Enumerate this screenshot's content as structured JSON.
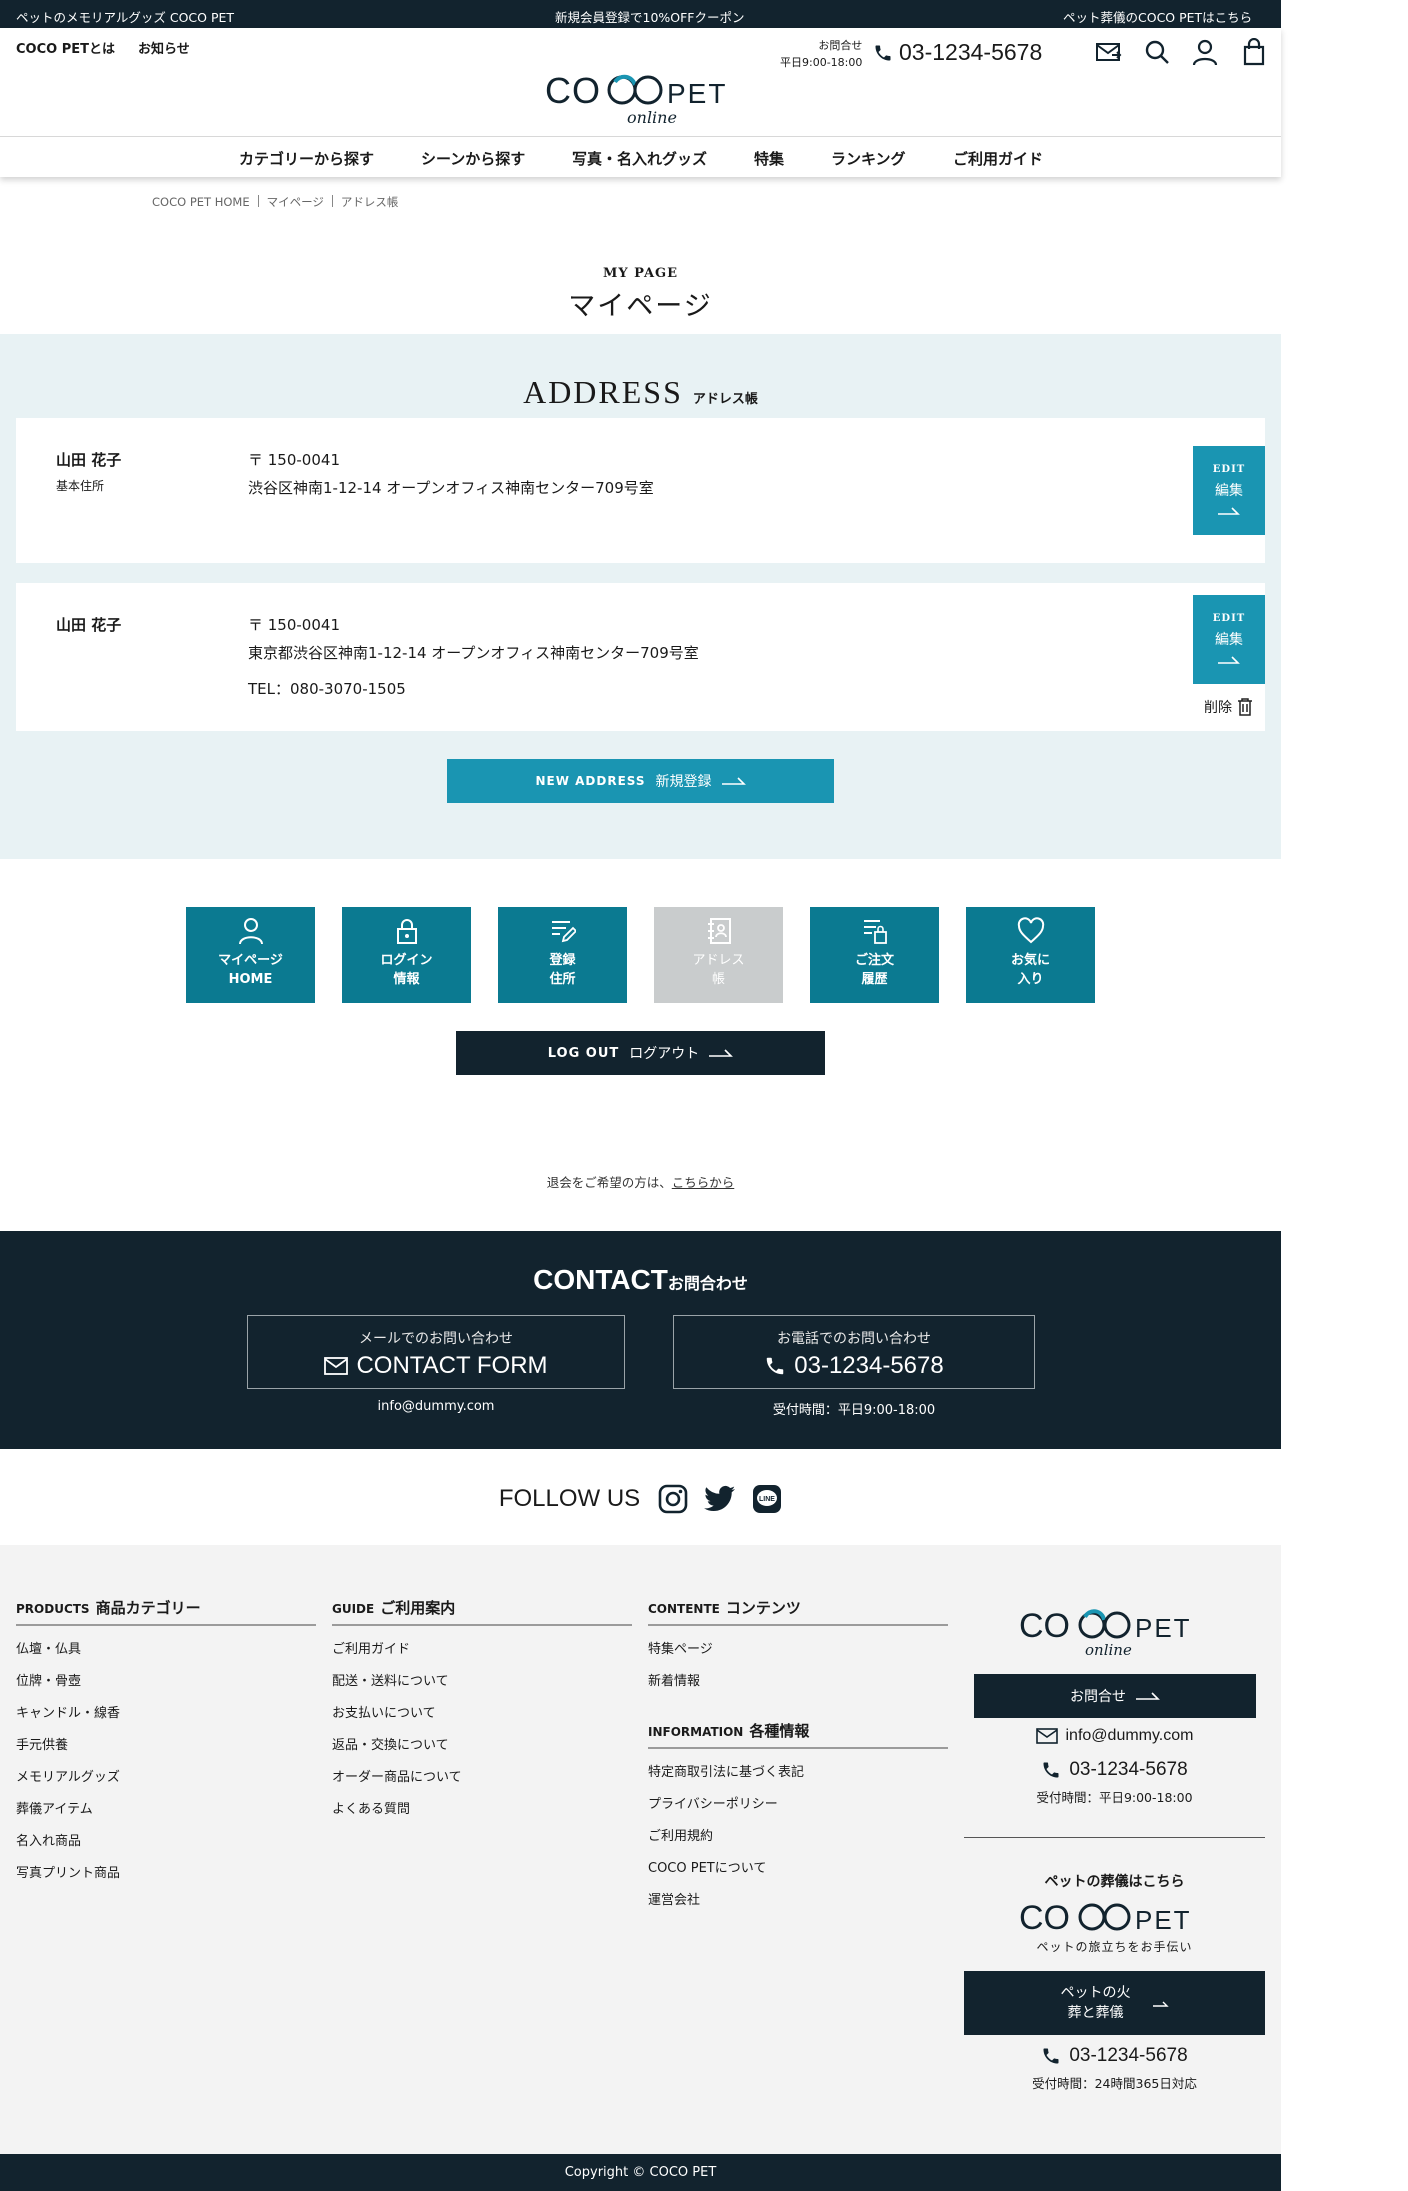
{
  "topbar": {
    "left": "ペットのメモリアルグッズ COCO PET",
    "center": "新規会員登録で10%OFFクーポン",
    "right": "ペット葬儀のCOCO PETはこちら"
  },
  "header": {
    "links": [
      "COCO PETとは",
      "お知らせ"
    ],
    "logo_main": "COCO PET",
    "logo_sub": "online",
    "hours_label": "お問合せ",
    "hours": "平日9:00-18:00",
    "phone": "03-1234-5678",
    "icons": [
      "mail-icon",
      "search-icon",
      "user-icon",
      "cart-icon"
    ]
  },
  "nav": [
    "カテゴリーから探す",
    "シーンから探す",
    "写真・名入れグッズ",
    "特集",
    "ランキング",
    "ご利用ガイド"
  ],
  "breadcrumb": [
    "COCO PET HOME",
    "マイページ",
    "アドレス帳"
  ],
  "page_title": {
    "en": "MY PAGE",
    "jp": "マイページ"
  },
  "address_section": {
    "title_en": "ADDRESS",
    "title_jp": "アドレス帳",
    "addresses": [
      {
        "name": "山田 花子",
        "tag": "基本住所",
        "postal": "〒 150-0041",
        "address": "渋谷区神南1-12-14 オープンオフィス神南センター709号室",
        "tel": ""
      },
      {
        "name": "山田 花子",
        "tag": "",
        "postal": "〒 150-0041",
        "address": "東京都渋谷区神南1-12-14 オープンオフィス神南センター709号室",
        "tel": "TEL：080-3070-1505"
      }
    ],
    "edit_en": "EDIT",
    "edit_jp": "編集",
    "delete_label": "削除",
    "new_en": "NEW ADDRESS",
    "new_jp": "新規登録"
  },
  "menu_tiles": [
    {
      "line1": "マイページ",
      "line2": "HOME",
      "icon": "user-icon",
      "active": true
    },
    {
      "line1": "ログイン",
      "line2": "情報",
      "icon": "lock-icon",
      "active": true
    },
    {
      "line1": "登録",
      "line2": "住所",
      "icon": "edit-list-icon",
      "active": true
    },
    {
      "line1": "アドレス",
      "line2": "帳",
      "icon": "address-book-icon",
      "active": false
    },
    {
      "line1": "ご注文",
      "line2": "履歴",
      "icon": "order-history-icon",
      "active": true
    },
    {
      "line1": "お気に",
      "line2": "入り",
      "icon": "heart-icon",
      "active": true
    }
  ],
  "logout": {
    "en": "LOG OUT",
    "jp": "ログアウト"
  },
  "withdraw": {
    "text": "退会をご希望の方は、",
    "link": "こちらから"
  },
  "contact": {
    "title_en": "CONTACT",
    "title_jp": "お問合わせ",
    "mail_sub": "メールでのお問い合わせ",
    "mail_main": "CONTACT FORM",
    "mail_addr": "info@dummy.com",
    "tel_sub": "お電話でのお問い合わせ",
    "tel_main": "03-1234-5678",
    "tel_hours": "受付時間：平日9:00-18:00"
  },
  "follow": {
    "label": "FOLLOW US",
    "icons": [
      "instagram-icon",
      "twitter-icon",
      "line-icon"
    ]
  },
  "footer": {
    "products": {
      "en": "PRODUCTS",
      "jp": "商品カテゴリー",
      "items": [
        "仏壇・仏具",
        "位牌・骨壺",
        "キャンドル・線香",
        "手元供養",
        "メモリアルグッズ",
        "葬儀アイテム",
        "名入れ商品",
        "写真プリント商品"
      ]
    },
    "guide": {
      "en": "GUIDE",
      "jp": "ご利用案内",
      "items": [
        "ご利用ガイド",
        "配送・送料について",
        "お支払いについて",
        "返品・交換について",
        "オーダー商品について",
        "よくある質問"
      ]
    },
    "contents": {
      "en": "CONTENTE",
      "jp": "コンテンツ",
      "items": [
        "特集ページ",
        "新着情報"
      ]
    },
    "information": {
      "en": "INFORMATION",
      "jp": "各種情報",
      "items": [
        "特定商取引法に基づく表記",
        "プライバシーポリシー",
        "ご利用規約",
        "COCO PETについて",
        "運営会社"
      ]
    },
    "right": {
      "logo_main": "COCO PET",
      "logo_sub": "online",
      "contact_btn": "お問合せ",
      "mail": "info@dummy.com",
      "phone": "03-1234-5678",
      "hours": "受付時間：平日9:00-18:00",
      "funeral_label": "ペットの葬儀はこちら",
      "funeral_logo": "COCO PET",
      "funeral_tagline": "ペットの旅立ちをお手伝い",
      "funeral_btn_l1": "ペットの火",
      "funeral_btn_l2": "葬と葬儀",
      "funeral_phone": "03-1234-5678",
      "funeral_hours": "受付時間：24時間365日対応"
    }
  },
  "copyright": "Copyright © COCO PET",
  "colors": {
    "navy": "#12232e",
    "teal": "#1a95b2",
    "teal_dark": "#0b7a91",
    "pale": "#e8f2f4",
    "disabled": "#c9cccd"
  }
}
